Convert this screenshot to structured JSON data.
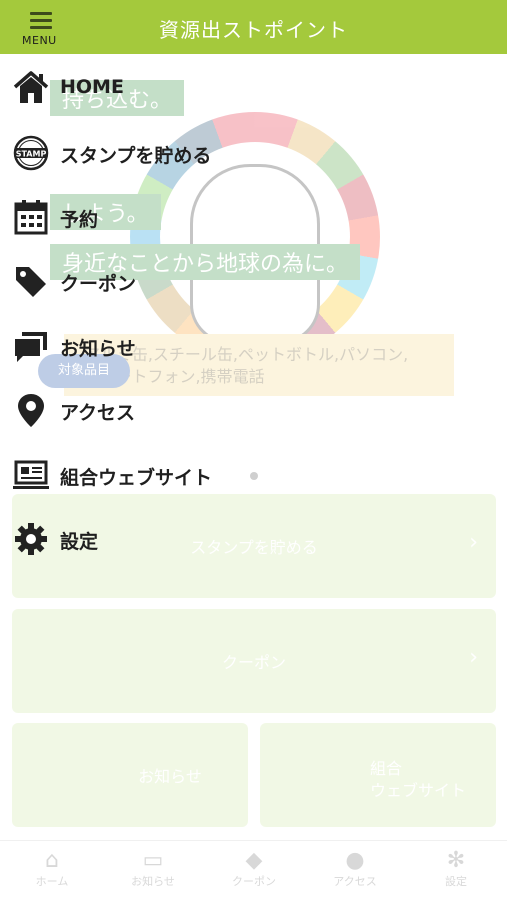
{
  "header": {
    "title": "資源出ストポイント",
    "menu_label": "MENU",
    "background": "#a4c93c"
  },
  "drawer": {
    "items": [
      {
        "label": "HOME",
        "icon": "home-icon"
      },
      {
        "label": "スタンプを貯める",
        "icon": "stamp-icon"
      },
      {
        "label": "予約",
        "icon": "calendar-icon"
      },
      {
        "label": "クーポン",
        "icon": "tag-icon"
      },
      {
        "label": "お知らせ",
        "icon": "chat-icon"
      },
      {
        "label": "アクセス",
        "icon": "location-pin-icon"
      },
      {
        "label": "組合ウェブサイト",
        "icon": "monitor-icon"
      },
      {
        "label": "設定",
        "icon": "gear-icon"
      }
    ]
  },
  "background_page": {
    "hero_lines": [
      "持ち込む。",
      "しよう。",
      "身近なことから地球の為に。"
    ],
    "target_tag": "対象品目",
    "target_text": [
      "アルミ缶,スチール缶,ペットボトル,パソコン,",
      "スマートフォン,携帯電話"
    ],
    "cards": {
      "stamp": "スタンプを貯める",
      "coupon": "クーポン",
      "news": "お知らせ",
      "website_line1": "組合",
      "website_line2": "ウェブサイト"
    },
    "tabs": [
      {
        "label": "ホーム",
        "icon": "home-icon"
      },
      {
        "label": "お知らせ",
        "icon": "chat-icon"
      },
      {
        "label": "クーポン",
        "icon": "tag-icon"
      },
      {
        "label": "アクセス",
        "icon": "location-pin-icon"
      },
      {
        "label": "設定",
        "icon": "gear-icon"
      }
    ]
  }
}
